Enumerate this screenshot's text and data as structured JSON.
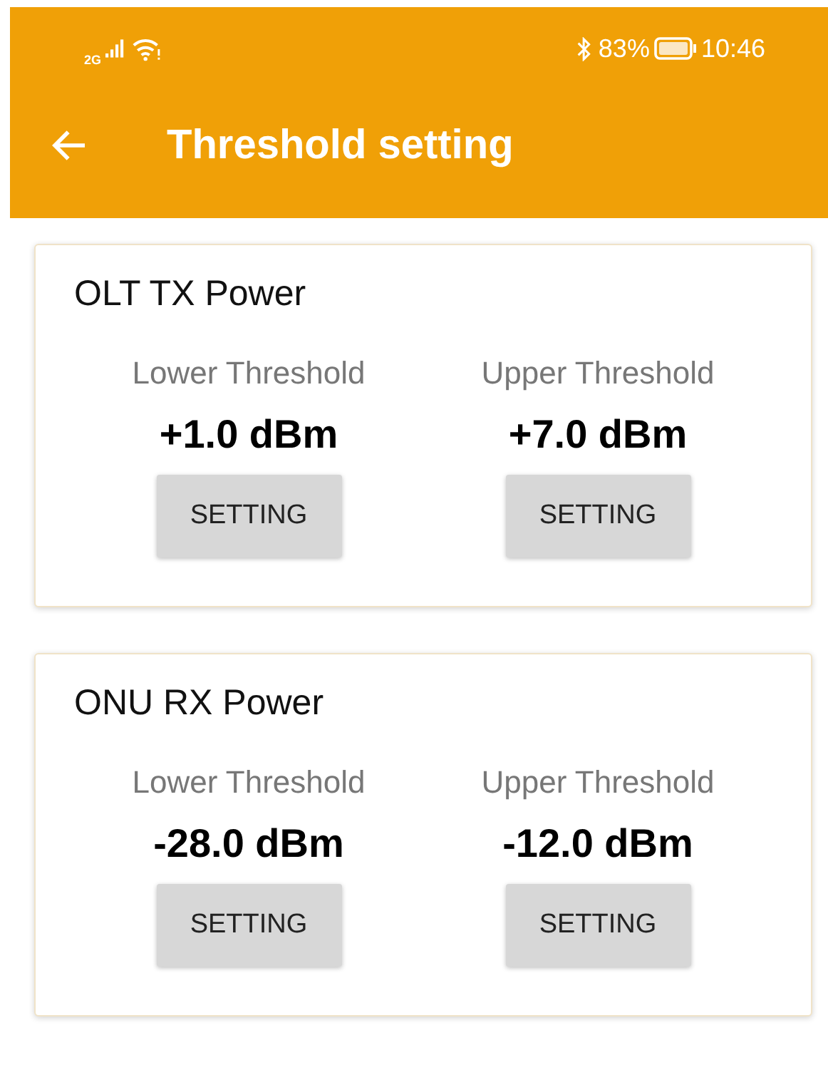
{
  "status_bar": {
    "network": "2G",
    "battery": "83%",
    "time": "10:46"
  },
  "toolbar": {
    "title": "Threshold setting"
  },
  "cards": [
    {
      "title": "OLT TX Power",
      "thresholds": [
        {
          "label": "Lower Threshold",
          "value": "+1.0 dBm",
          "button": "SETTING"
        },
        {
          "label": "Upper Threshold",
          "value": "+7.0 dBm",
          "button": "SETTING"
        }
      ]
    },
    {
      "title": "ONU RX Power",
      "thresholds": [
        {
          "label": "Lower Threshold",
          "value": "-28.0 dBm",
          "button": "SETTING"
        },
        {
          "label": "Upper Threshold",
          "value": "-12.0 dBm",
          "button": "SETTING"
        }
      ]
    }
  ]
}
